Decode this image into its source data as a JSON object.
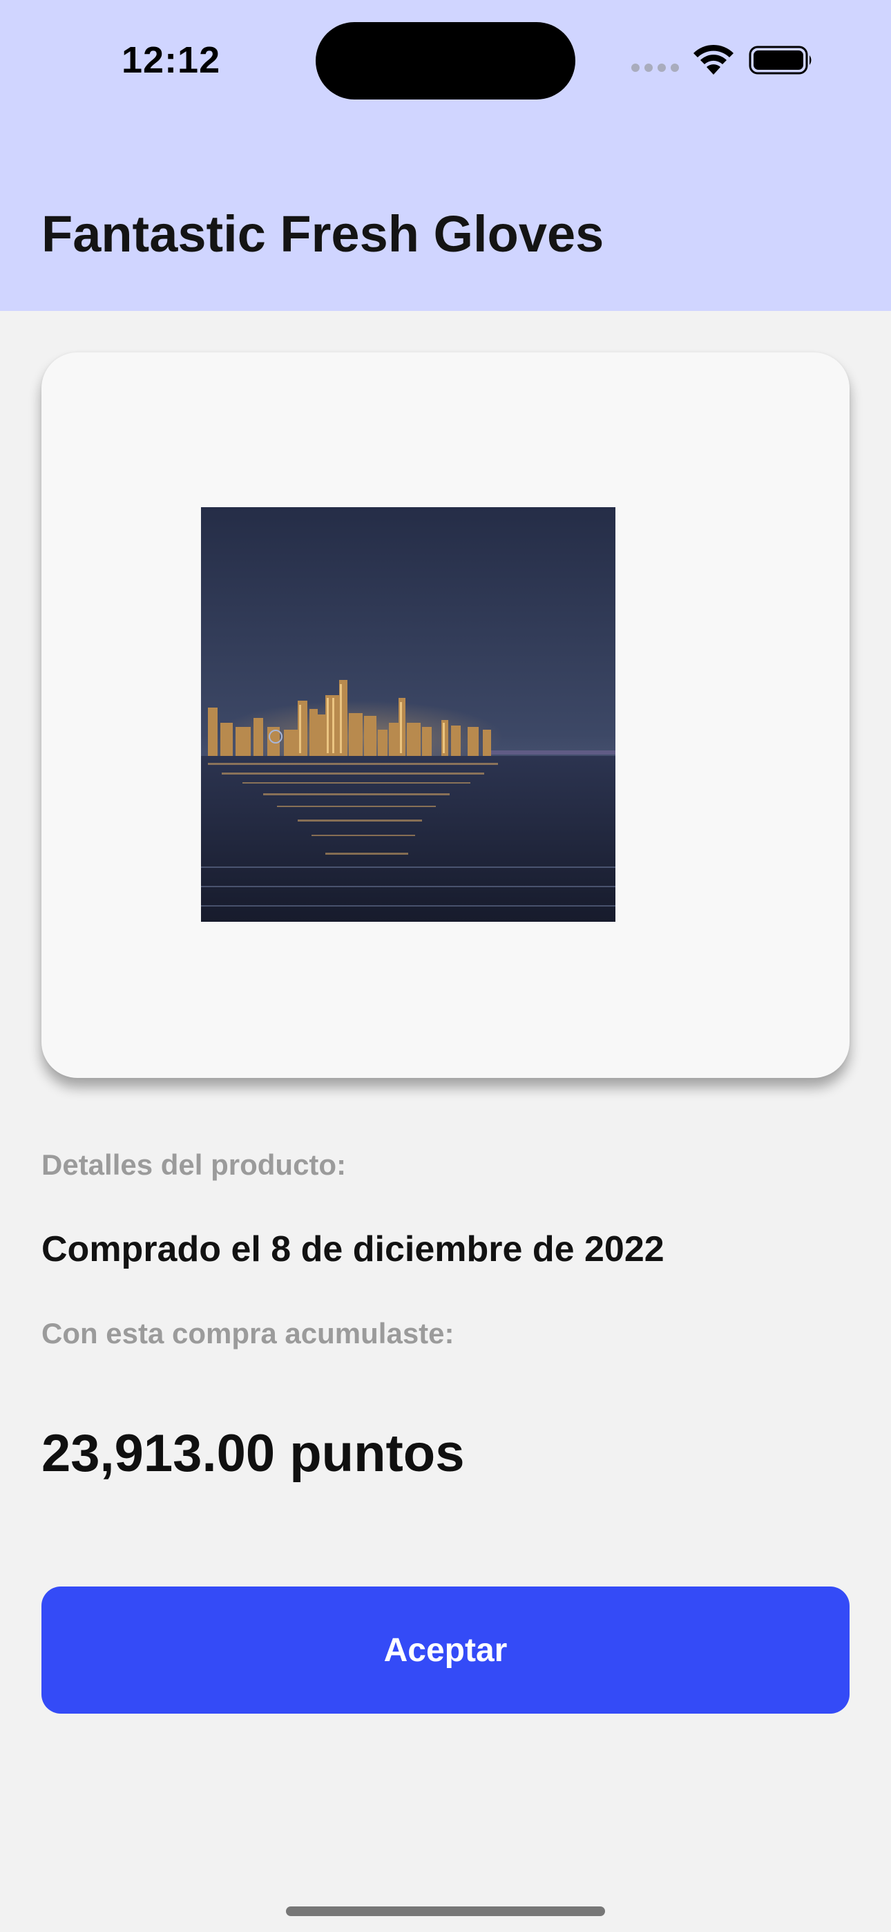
{
  "status_bar": {
    "time": "12:12"
  },
  "header": {
    "title": "Fantastic Fresh Gloves"
  },
  "product": {
    "image_icon": "city-skyline-night-photo",
    "details_label": "Detalles del producto:",
    "purchase_date": "Comprado el 8 de diciembre de 2022",
    "points_label": "Con esta compra acumulaste:",
    "points_value": "23,913.00 puntos"
  },
  "actions": {
    "accept_label": "Aceptar"
  },
  "colors": {
    "header_background": "#d0d5ff",
    "page_background": "#f2f2f2",
    "accent": "#344bf7"
  }
}
